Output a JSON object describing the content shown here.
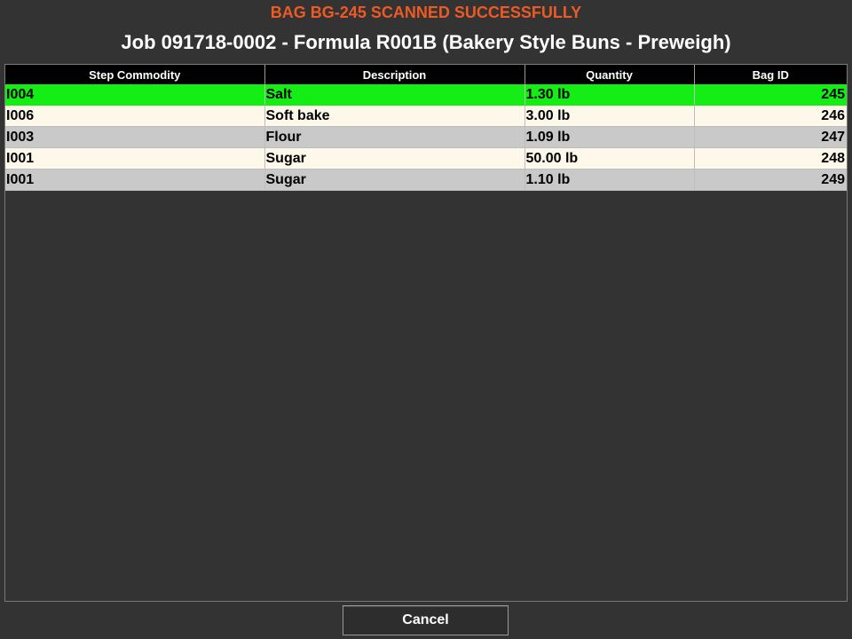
{
  "status": {
    "message": "BAG BG-245 SCANNED SUCCESSFULLY",
    "color": "#ee5a24"
  },
  "header": {
    "title": "Job 091718-0002 - Formula R001B (Bakery Style Buns - Preweigh)"
  },
  "grid": {
    "columns": [
      "Step Commodity",
      "Description",
      "Quantity",
      "Bag ID"
    ],
    "selected_row_color": "#14ee14",
    "rows": [
      {
        "commodity": "I004",
        "description": "Salt",
        "quantity": "1.30 lb",
        "bag_id": "245",
        "selected": true
      },
      {
        "commodity": "I006",
        "description": "Soft bake",
        "quantity": "3.00 lb",
        "bag_id": "246",
        "selected": false
      },
      {
        "commodity": "I003",
        "description": "Flour",
        "quantity": "1.09 lb",
        "bag_id": "247",
        "selected": false
      },
      {
        "commodity": "I001",
        "description": "Sugar",
        "quantity": "50.00 lb",
        "bag_id": "248",
        "selected": false
      },
      {
        "commodity": "I001",
        "description": "Sugar",
        "quantity": "1.10 lb",
        "bag_id": "249",
        "selected": false
      }
    ]
  },
  "footer": {
    "cancel_label": "Cancel"
  }
}
